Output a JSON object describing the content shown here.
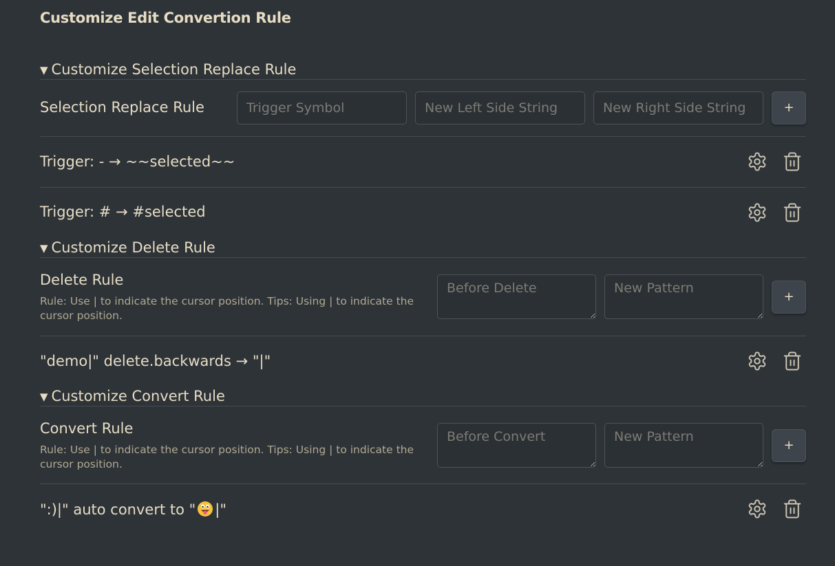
{
  "page": {
    "title": "Customize Edit Convertion Rule"
  },
  "sections": {
    "selection": {
      "header": "Customize Selection Replace Rule",
      "form_label": "Selection Replace Rule",
      "trigger_placeholder": "Trigger Symbol",
      "left_placeholder": "New Left Side String",
      "right_placeholder": "New Right Side String",
      "add_label": "+",
      "rules": [
        {
          "text": "Trigger: - → ~~selected~~"
        },
        {
          "text": "Trigger: # → #selected"
        }
      ]
    },
    "delete": {
      "header": "Customize Delete Rule",
      "form_label": "Delete Rule",
      "description": "Rule: Use | to indicate the cursor position. Tips: Using | to indicate the cursor position.",
      "before_placeholder": "Before Delete",
      "pattern_placeholder": "New Pattern",
      "add_label": "+",
      "rules": [
        {
          "text": "\"demo|\" delete.backwards → \"|\""
        }
      ]
    },
    "convert": {
      "header": "Customize Convert Rule",
      "form_label": "Convert Rule",
      "description": "Rule: Use | to indicate the cursor position. Tips: Using | to indicate the cursor position.",
      "before_placeholder": "Before Convert",
      "pattern_placeholder": "New Pattern",
      "add_label": "+",
      "rules": [
        {
          "prefix": "\":)|\" auto convert to \"",
          "emoji": "grinning-face-with-tongue",
          "suffix": "|\""
        }
      ]
    }
  },
  "icons": {
    "settings": "gear-icon",
    "delete": "trash-icon",
    "collapse": "triangle-down-icon"
  },
  "colors": {
    "background": "#2e3338",
    "text": "#e6dcc4",
    "muted_text": "#b0a992",
    "placeholder": "#7d7c74",
    "border": "#474c52",
    "button": "#3e444b"
  }
}
